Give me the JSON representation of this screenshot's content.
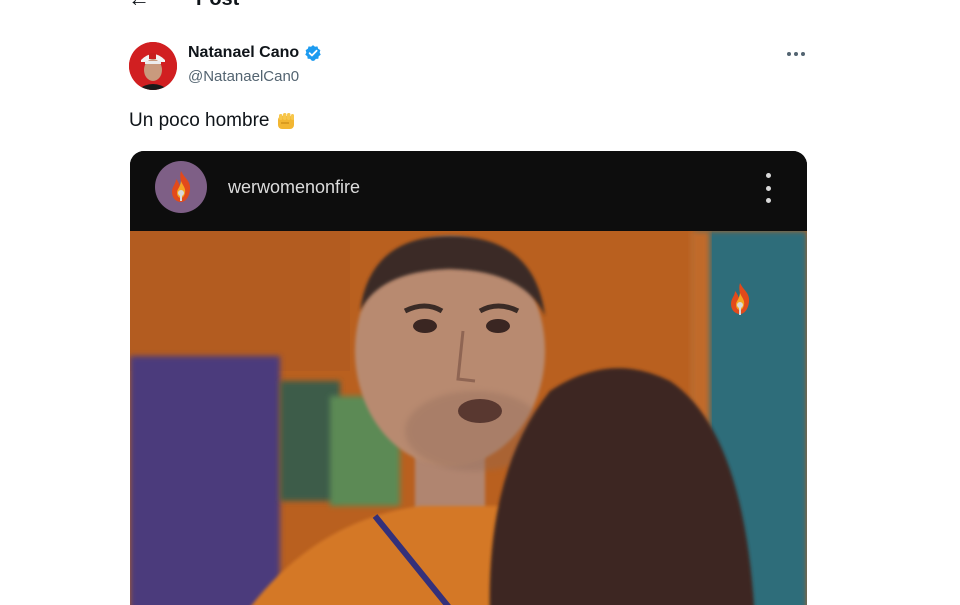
{
  "header": {
    "back_icon": "arrow-left-icon",
    "title": "Post"
  },
  "author": {
    "name": "Natanael Cano",
    "handle": "@NatanaelCan0",
    "verified": true,
    "verified_color": "#1d9bf0",
    "avatar_color": "#d11f21"
  },
  "post": {
    "text": "Un poco hombre",
    "emoji_icon": "oncoming-fist-icon"
  },
  "media": {
    "account": "werwomenonfire",
    "more_icon": "vertical-ellipsis-icon",
    "flame_icon": "flame-logo-icon",
    "background_colors": {
      "header": "#0d0d0d",
      "wall": "#b85f1e",
      "shirt": "#d9792a",
      "hair": "#3b2520"
    }
  },
  "more_options_icon": "horizontal-ellipsis-icon"
}
